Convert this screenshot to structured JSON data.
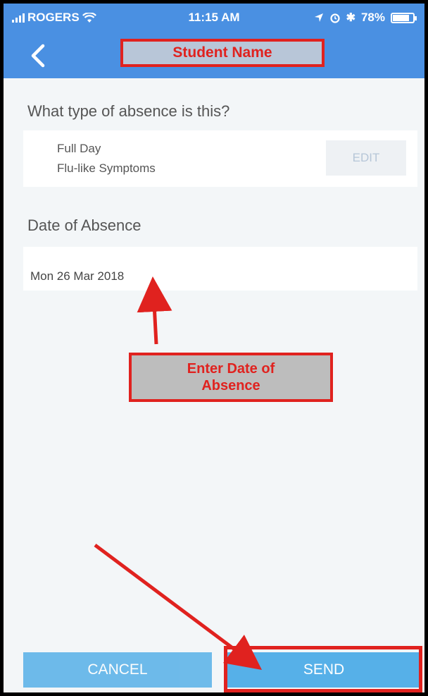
{
  "status_bar": {
    "carrier": "ROGERS",
    "time": "11:15 AM",
    "battery": "78%",
    "battery_level": 0.78
  },
  "header": {
    "title": "Student Name"
  },
  "absence_type": {
    "question": "What type of absence is this?",
    "duration": "Full Day",
    "reason": "Flu-like Symptoms",
    "edit_label": "EDIT"
  },
  "date_section": {
    "label": "Date of Absence",
    "value": "Mon 26 Mar 2018"
  },
  "annotation": {
    "text": "Enter Date of Absence"
  },
  "actions": {
    "cancel_label": "CANCEL",
    "send_label": "SEND"
  },
  "colors": {
    "header": "#4a90e2",
    "button": "#56b0e8",
    "annotation": "#e0221f",
    "background": "#f3f6f8"
  }
}
